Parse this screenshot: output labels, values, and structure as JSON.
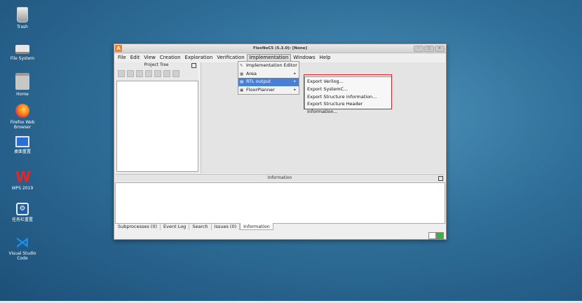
{
  "desktop": {
    "icons": [
      {
        "label": "Trash",
        "icon": "trash-icon"
      },
      {
        "label": "File System",
        "icon": "drive-icon"
      },
      {
        "label": "Home",
        "icon": "home-folder-icon"
      },
      {
        "label": "Firefox Web Browser",
        "icon": "firefox-icon"
      },
      {
        "label": "桌面重置",
        "icon": "monitor-icon"
      },
      {
        "label": "WPS 2019",
        "icon": "wps-icon"
      },
      {
        "label": "任务栏重置",
        "icon": "settings-icon"
      },
      {
        "label": "Visual Studio Code",
        "icon": "vscode-icon"
      }
    ]
  },
  "window": {
    "title": "FlexNoC5 (5.3.0): [None]",
    "app_icon_letter": "A"
  },
  "menubar": [
    "File",
    "Edit",
    "View",
    "Creation",
    "Exploration",
    "Verification",
    "Implementation",
    "Windows",
    "Help"
  ],
  "project_tree": {
    "title": "Project Tree"
  },
  "dropdown": {
    "items": [
      {
        "label": "Implementation Editor",
        "icon": "wrench-icon",
        "submenu": false
      },
      {
        "label": "Area",
        "icon": "area-icon",
        "submenu": true
      },
      {
        "label": "RTL output",
        "icon": "rtl-icon",
        "submenu": true
      },
      {
        "label": "FloorPlanner",
        "icon": "floorplan-icon",
        "submenu": true
      }
    ]
  },
  "submenu": {
    "items": [
      "Export Verilog...",
      "Export SystemC...",
      "Export Structure information...",
      "Export Structure Header information..."
    ]
  },
  "information": {
    "title": "Information"
  },
  "tabs": [
    "Subprocesses (0)",
    "Event Log",
    "Search",
    "Issues (0)",
    "Information"
  ],
  "colors": {
    "highlight": "#4a7fd4",
    "annotation_box": "#e21f26",
    "app_icon": "#f08020"
  }
}
